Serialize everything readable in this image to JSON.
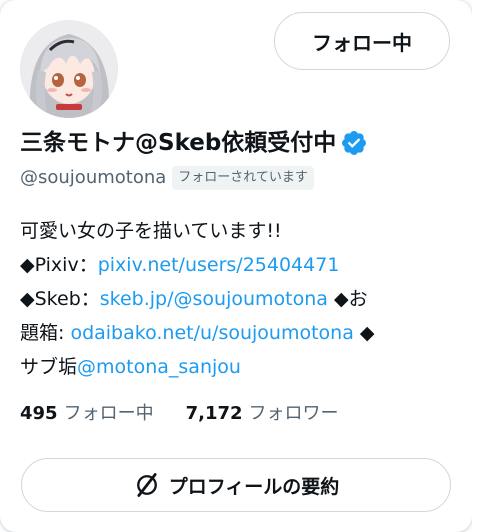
{
  "profile": {
    "display_name": "三条モトナ@Skeb依頼受付中",
    "handle": "@soujoumotona",
    "follows_you_badge": "フォローされています",
    "follow_button_label": "フォロー中",
    "verified_icon": "verified-badge-icon",
    "avatar_icon": "avatar"
  },
  "bio": {
    "line1": "可愛い女の子を描いています!!",
    "pixiv_prefix": "◆Pixiv：",
    "pixiv_link": "pixiv.net/users/25404471",
    "skeb_prefix": "◆Skeb：",
    "skeb_link": "skeb.jp/@soujoumotona",
    "odaibako_prefix_a": " ◆お",
    "odaibako_prefix_b": "題箱: ",
    "odaibako_link": "odaibako.net/u/soujoumotona",
    "sub_prefix_a": " ◆",
    "sub_prefix_b": "サブ垢",
    "sub_link": "@motona_sanjou"
  },
  "stats": {
    "following_count": "495",
    "following_label": "フォロー中",
    "followers_count": "7,172",
    "followers_label": "フォロワー"
  },
  "summary_button_label": "プロフィールの要約",
  "summary_icon": "grok-slash-icon",
  "colors": {
    "accent": "#1d9bf0",
    "secondary_text": "#536471",
    "border": "#cfd9de"
  }
}
